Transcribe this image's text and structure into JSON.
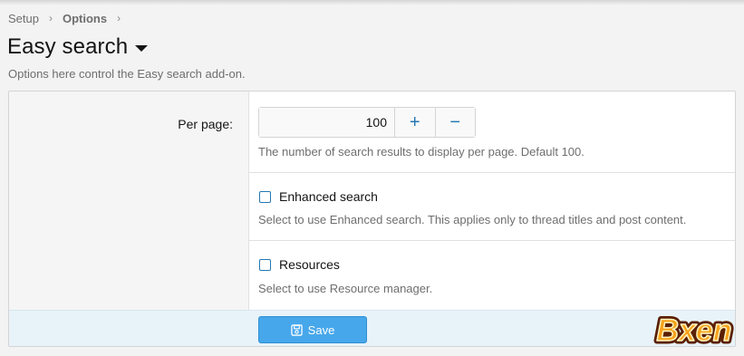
{
  "breadcrumb": {
    "items": [
      "Setup",
      "Options"
    ]
  },
  "header": {
    "title": "Easy search",
    "description": "Options here control the Easy search add-on."
  },
  "options": {
    "per_page": {
      "label": "Per page:",
      "value": "100",
      "plus_symbol": "+",
      "minus_symbol": "−",
      "hint": "The number of search results to display per page. Default 100."
    },
    "enhanced_search": {
      "label": "Enhanced search",
      "checked": false,
      "hint": "Select to use Enhanced search. This applies only to thread titles and post content."
    },
    "resources": {
      "label": "Resources",
      "checked": false,
      "hint": "Select to use Resource manager."
    }
  },
  "footer": {
    "save_label": "Save"
  },
  "watermark": {
    "text": "Bxen"
  },
  "colors": {
    "accent": "#2577b1",
    "button": "#47a7eb",
    "footer_bg": "#e8f3f9"
  }
}
